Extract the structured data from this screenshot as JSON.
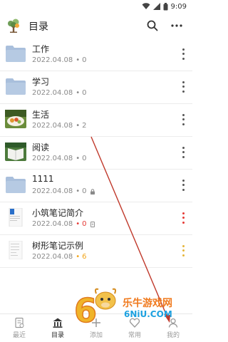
{
  "status_bar": {
    "time": "9:09"
  },
  "app_bar": {
    "title": "目录",
    "icons": [
      "tree-logo-icon",
      "search-icon",
      "more-icon"
    ]
  },
  "items": [
    {
      "name": "工作",
      "date": "2022.04.08",
      "count": "0",
      "kind": "folder"
    },
    {
      "name": "学习",
      "date": "2022.04.08",
      "count": "0",
      "kind": "folder"
    },
    {
      "name": "生活",
      "date": "2022.04.08",
      "count": "2",
      "kind": "photo-food"
    },
    {
      "name": "阅读",
      "date": "2022.04.08",
      "count": "0",
      "kind": "photo-book"
    },
    {
      "name": "1111",
      "date": "2022.04.08",
      "count": "0",
      "kind": "folder",
      "badge": "lock-icon"
    },
    {
      "name": "小筑笔记简介",
      "date": "2022.04.08",
      "count": "0",
      "kind": "document",
      "badge": "doc-icon",
      "count_color": "#e53935",
      "menu_color": "#e53935"
    },
    {
      "name": "树形笔记示例",
      "date": "2022.04.08",
      "count": "6",
      "kind": "document",
      "count_color": "#f2a51a",
      "menu_color": "#e5b53a"
    }
  ],
  "bottom_nav": [
    {
      "label": "最近",
      "icon": "recent-icon",
      "active": false
    },
    {
      "label": "目录",
      "icon": "catalog-icon",
      "active": true
    },
    {
      "label": "添加",
      "icon": "add-icon",
      "active": false
    },
    {
      "label": "常用",
      "icon": "heart-icon",
      "active": false
    },
    {
      "label": "我的",
      "icon": "profile-icon",
      "active": false
    }
  ],
  "watermark": {
    "text": "乐牛游戏网",
    "sub": "6NiU.COM"
  },
  "colors": {
    "folder": "#a9bfdc",
    "accent_red": "#e53935",
    "accent_orange": "#f2a51a",
    "annotation_arrow": "#c0392b"
  }
}
